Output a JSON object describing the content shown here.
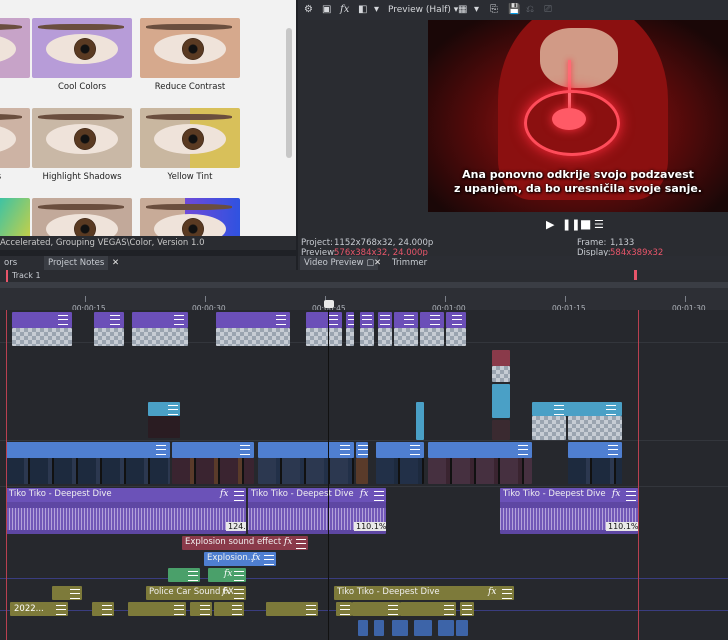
{
  "fx_browser": {
    "items": [
      {
        "label": "Cool Colors",
        "tint": "#a68ed6"
      },
      {
        "label": "Reduce Contrast",
        "tint": "#cfa58a"
      },
      {
        "label": "Highlight Shadows",
        "tint": "#c9b7a0"
      },
      {
        "label": "Yellow Tint",
        "tint": "#d9c05a"
      }
    ],
    "partial_label": "s",
    "status": "Accelerated, Grouping VEGAS\\Color, Version 1.0"
  },
  "left_tabs": {
    "tab1": "ors",
    "tab2": "Project Notes"
  },
  "preview": {
    "quality": "Preview (Half)",
    "subtitle_line1": "Ana ponovno odkrije svojo podzavest",
    "subtitle_line2": "z upanjem, da bo uresničila svoje sanje.",
    "project_label": "Project:",
    "project_value": "1152x768x32, 24.000p",
    "preview_label": "Preview:",
    "preview_value": "576x384x32, 24.000p",
    "frame_label": "Frame:",
    "frame_value": "1,133",
    "display_label": "Display:",
    "display_value": "584x389x32",
    "tab_video_preview": "Video Preview",
    "tab_trimmer": "Trimmer",
    "accent_red": "#e8556a"
  },
  "timeline": {
    "track_name": "Track 1",
    "ruler": [
      "00:00:15",
      "00:00:30",
      "00:00:45",
      "00:01:00",
      "00:01:15",
      "00:01:30"
    ],
    "audio_clip_1": "Tiko Tiko - Deepest Dive",
    "audio_clip_2": "Tiko Tiko - Deepest Dive",
    "audio_clip_3": "Tiko Tiko - Deepest Dive",
    "audio_clip_4": "Tiko Tiko - Deepest Dive",
    "pct_1": "124.3%",
    "pct_2": "110.1%",
    "pct_3": "110.1%",
    "sfx_1": "Explosion sound effect",
    "sfx_2": "Explosion...",
    "sfx_3": "Police Car Sound FX",
    "small_label": "2022...",
    "fx_glyph": "fx",
    "colors": {
      "video": "#4f7fd1",
      "audio": "#6b4fb0",
      "sfx_red": "#8a3a4a",
      "sfx_olive": "#7d7a3a",
      "green": "#4aa06a"
    }
  }
}
